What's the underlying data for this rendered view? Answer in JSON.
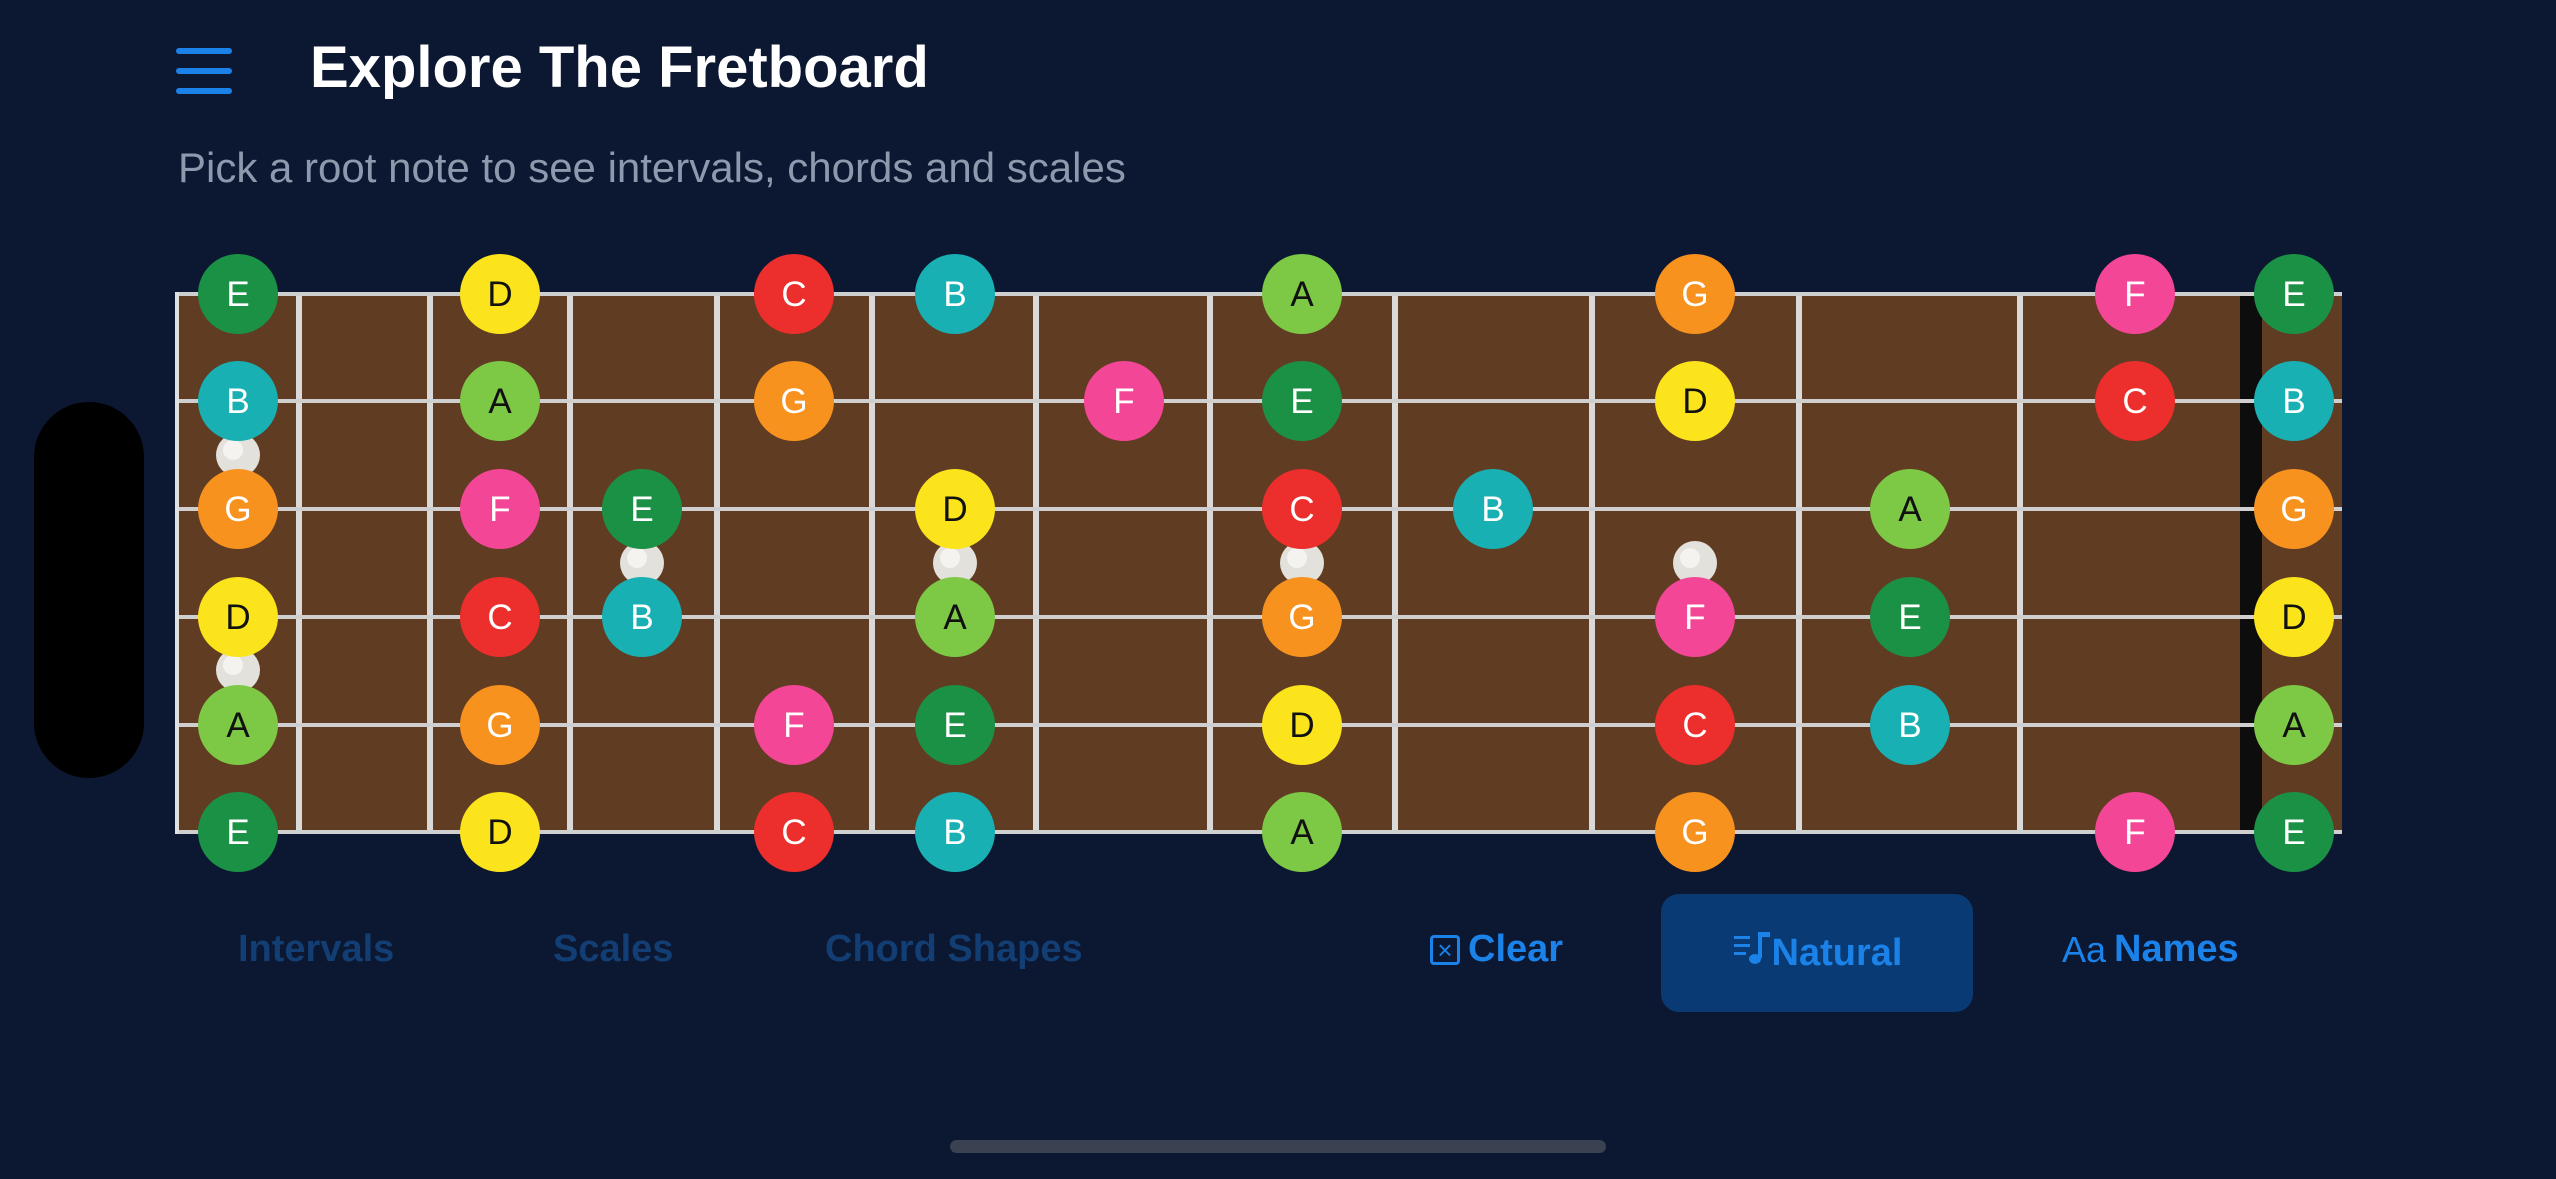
{
  "header": {
    "title": "Explore The Fretboard",
    "subtitle": "Pick a root note to see intervals, chords and scales"
  },
  "colors": {
    "background": "#0c1731",
    "fretboard_wood": "#603c23",
    "accent": "#1a82e8",
    "note_colors": {
      "E": "#1b9146",
      "B": "#19b0b3",
      "G": "#f8921f",
      "D": "#fce41c",
      "A": "#7dc845",
      "C": "#ec2e2c",
      "F": "#f44696"
    }
  },
  "fretboard": {
    "strings_top_to_bottom": [
      {
        "open": "E",
        "notes": [
          "E",
          "D",
          "C",
          "B",
          "A",
          "G",
          "F",
          "E"
        ]
      },
      {
        "open": "B",
        "notes": [
          "B",
          "A",
          "G",
          "F",
          "E",
          "D",
          "C",
          "B"
        ]
      },
      {
        "open": "G",
        "notes": [
          "G",
          "F",
          "E",
          "D",
          "C",
          "B",
          "A",
          "G"
        ]
      },
      {
        "open": "D",
        "notes": [
          "D",
          "C",
          "B",
          "A",
          "G",
          "F",
          "E",
          "D"
        ]
      },
      {
        "open": "A",
        "notes": [
          "A",
          "G",
          "F",
          "E",
          "D",
          "C",
          "B",
          "A"
        ]
      },
      {
        "open": "E",
        "notes": [
          "E",
          "D",
          "C",
          "B",
          "A",
          "G",
          "F",
          "E"
        ]
      }
    ],
    "note_positions": [
      [
        0,
        2,
        4,
        5,
        7,
        10,
        13,
        16
      ],
      [
        0,
        2,
        4,
        6,
        7,
        10,
        13,
        16
      ],
      [
        0,
        2,
        3,
        5,
        7,
        8,
        11,
        16
      ],
      [
        0,
        2,
        3,
        5,
        7,
        10,
        11,
        16
      ],
      [
        0,
        2,
        4,
        5,
        7,
        10,
        11,
        16
      ],
      [
        0,
        2,
        4,
        5,
        7,
        10,
        13,
        16
      ]
    ],
    "fret_markers": [
      1,
      3,
      5,
      7,
      9
    ]
  },
  "tabs": [
    {
      "label": "Intervals"
    },
    {
      "label": "Scales"
    },
    {
      "label": "Chord Shapes"
    }
  ],
  "actions": {
    "clear": {
      "label": "Clear",
      "icon": "clear-box-icon"
    },
    "natural": {
      "label": "Natural",
      "icon": "music-note-list-icon"
    },
    "names": {
      "label": "Names",
      "icon_text": "Aa"
    }
  }
}
